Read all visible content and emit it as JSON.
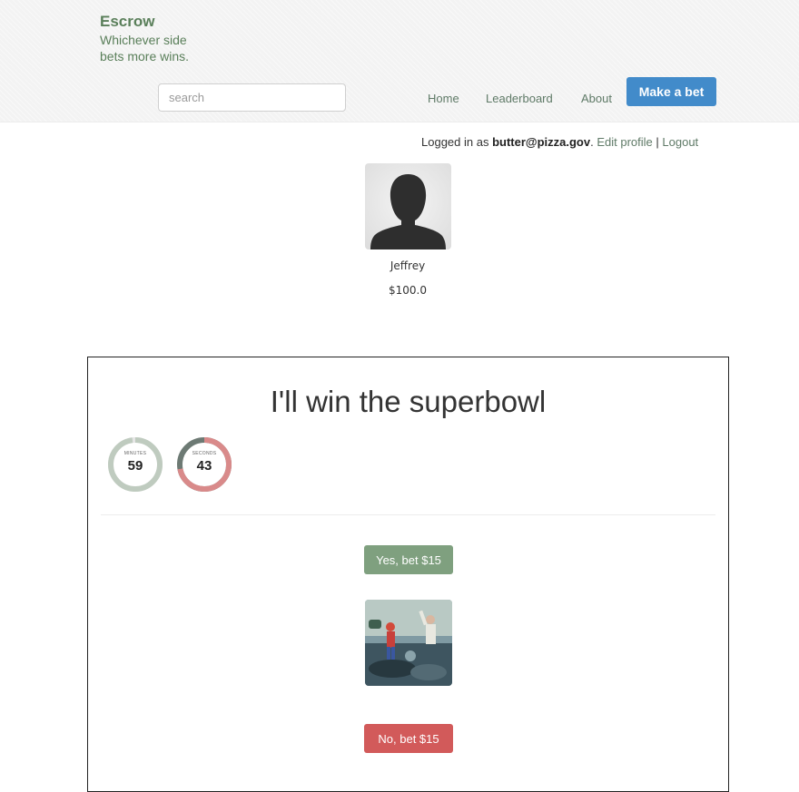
{
  "brand": {
    "title": "Escrow",
    "tagline": "Whichever side bets more wins."
  },
  "search": {
    "placeholder": "search",
    "value": ""
  },
  "nav": {
    "home": "Home",
    "leaderboard": "Leaderboard",
    "about": "About",
    "make_bet": "Make a bet"
  },
  "session": {
    "prefix": "Logged in as",
    "email": "butter@pizza.gov",
    "suffix": ".",
    "edit_profile": "Edit profile",
    "separator": "|",
    "logout": "Logout"
  },
  "profile": {
    "name": "Jeffrey",
    "balance": "$100.0",
    "avatar_icon": "person-silhouette-icon"
  },
  "bet": {
    "title": "I'll win the superbowl",
    "timers": {
      "minutes": {
        "label": "MINUTES",
        "value": "59",
        "fraction_remaining": 0.98,
        "color": "#bfcbbf"
      },
      "seconds": {
        "label": "SECONDS",
        "value": "43",
        "fraction_remaining": 0.72,
        "color": "#d98a8a"
      }
    },
    "yes_label": "Yes, bet $15",
    "no_label": "No, bet $15",
    "colors": {
      "yes": "#7fa07f",
      "no": "#d25a5a",
      "accent": "#428bca"
    }
  }
}
